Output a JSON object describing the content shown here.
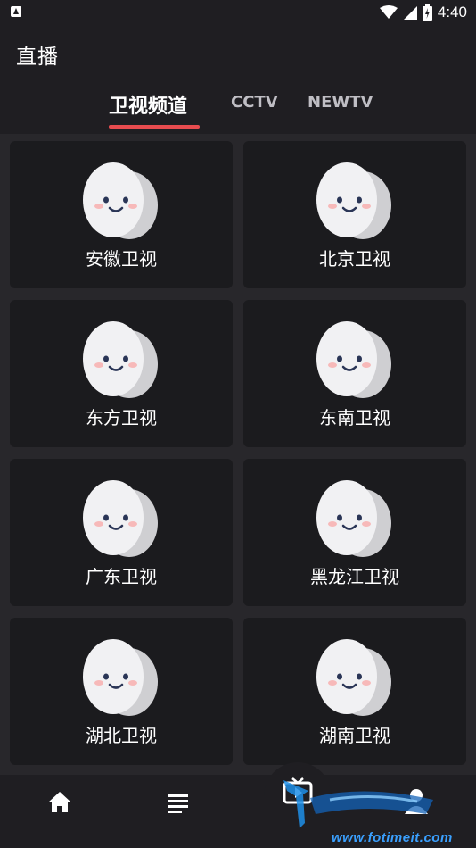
{
  "status_bar": {
    "time": "4:40"
  },
  "header": {
    "title": "直播"
  },
  "tabs": [
    {
      "label": "卫视频道",
      "active": true
    },
    {
      "label": "CCTV",
      "active": false
    },
    {
      "label": "NEWTV",
      "active": false
    }
  ],
  "channels": [
    {
      "name": "安徽卫视"
    },
    {
      "name": "北京卫视"
    },
    {
      "name": "东方卫视"
    },
    {
      "name": "东南卫视"
    },
    {
      "name": "广东卫视"
    },
    {
      "name": "黑龙江卫视"
    },
    {
      "name": "湖北卫视"
    },
    {
      "name": "湖南卫视"
    }
  ],
  "bottom_nav": [
    {
      "icon": "home-icon"
    },
    {
      "icon": "list-icon"
    },
    {
      "icon": "tv-icon"
    },
    {
      "icon": "profile-icon"
    }
  ],
  "watermark": {
    "text": "www.fotimeit.com"
  },
  "colors": {
    "accent": "#e84c4f",
    "background": "#28272b",
    "card": "#1b1b1e",
    "bar": "#1f1e22"
  }
}
